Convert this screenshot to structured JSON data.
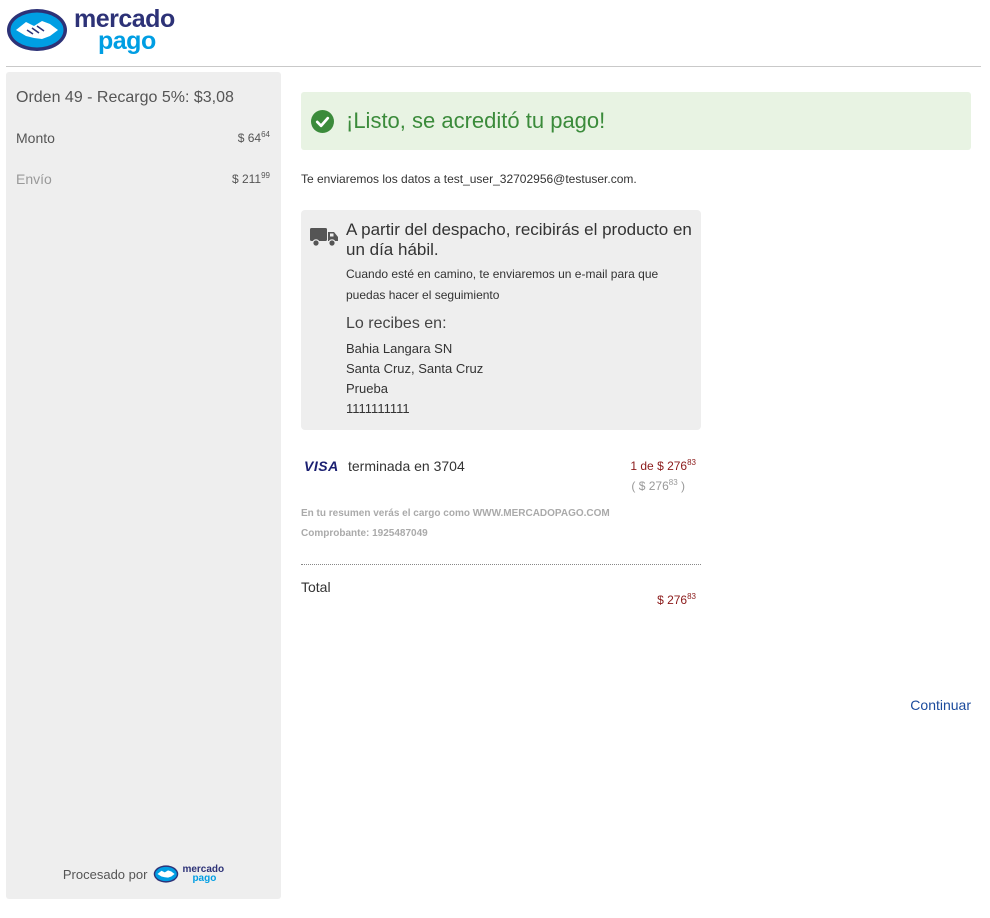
{
  "brand": {
    "line1": "mercado",
    "line2": "pago",
    "processed_by": "Procesado por",
    "colors": {
      "navy": "#2d3277",
      "blue": "#009ee3"
    }
  },
  "sidebar": {
    "order_title": "Orden 49 - Recargo 5%: $3,08",
    "items": [
      {
        "label": "Monto",
        "amount": "$ 64",
        "cents": "64"
      },
      {
        "label": "Envío",
        "amount": "$ 211",
        "cents": "99"
      }
    ]
  },
  "success": {
    "message": "¡Listo, se acreditó tu pago!",
    "color": "#3b8b3b"
  },
  "email_notice": "Te enviaremos los datos a test_user_32702956@testuser.com.",
  "shipping": {
    "title": "A partir del despacho, recibirás el producto en un día hábil.",
    "subtitle": "Cuando esté en camino, te enviaremos un e-mail para que puedas hacer el seguimiento",
    "receive_title": "Lo recibes en:",
    "address": [
      "Bahia Langara SN",
      "Santa Cruz, Santa Cruz",
      "Prueba",
      "1111111111"
    ]
  },
  "payment": {
    "brand": "VISA",
    "card_text": "terminada en 3704",
    "installments": "1 de $ 276",
    "installments_cents": "83",
    "total_paren_open": "( $ 276",
    "total_paren_cents": "83",
    "total_paren_close": " )",
    "statement": "En tu resumen verás el cargo como WWW.MERCADOPAGO.COM",
    "voucher": "Comprobante: 1925487049"
  },
  "total": {
    "label": "Total",
    "amount": "$ 276",
    "cents": "83"
  },
  "actions": {
    "continue": "Continuar"
  }
}
